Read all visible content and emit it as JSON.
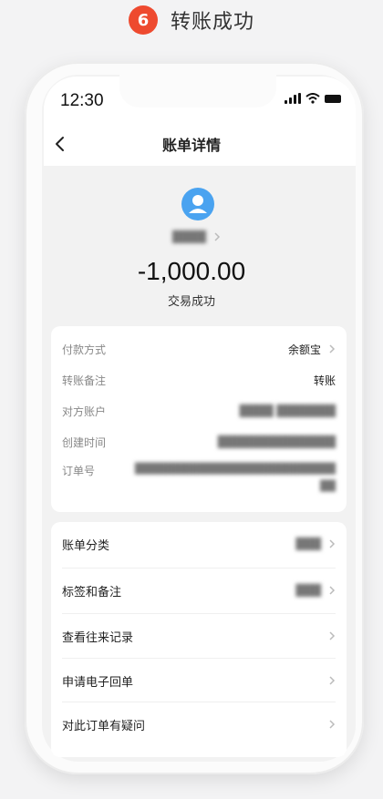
{
  "step": {
    "number": "6",
    "title": "转账成功"
  },
  "status_bar": {
    "time": "12:30"
  },
  "nav": {
    "title": "账单详情"
  },
  "summary": {
    "name": "████",
    "amount": "-1,000.00",
    "status": "交易成功"
  },
  "details": [
    {
      "label": "付款方式",
      "value": "余额宝",
      "has_arrow": true
    },
    {
      "label": "转账备注",
      "value": "转账"
    },
    {
      "label": "对方账户",
      "value": "████ ███████"
    },
    {
      "label": "创建时间",
      "value": "██████████████"
    },
    {
      "label": "订单号",
      "value": "██████████████████████████",
      "value_line2": "██"
    }
  ],
  "actions": [
    {
      "label": "账单分类",
      "value": "███"
    },
    {
      "label": "标签和备注",
      "value": "███"
    },
    {
      "label": "查看往来记录",
      "value": ""
    },
    {
      "label": "申请电子回单",
      "value": ""
    },
    {
      "label": "对此订单有疑问",
      "value": ""
    }
  ],
  "colors": {
    "badge": "#ee4a2f",
    "avatar": "#4aa3f0"
  }
}
